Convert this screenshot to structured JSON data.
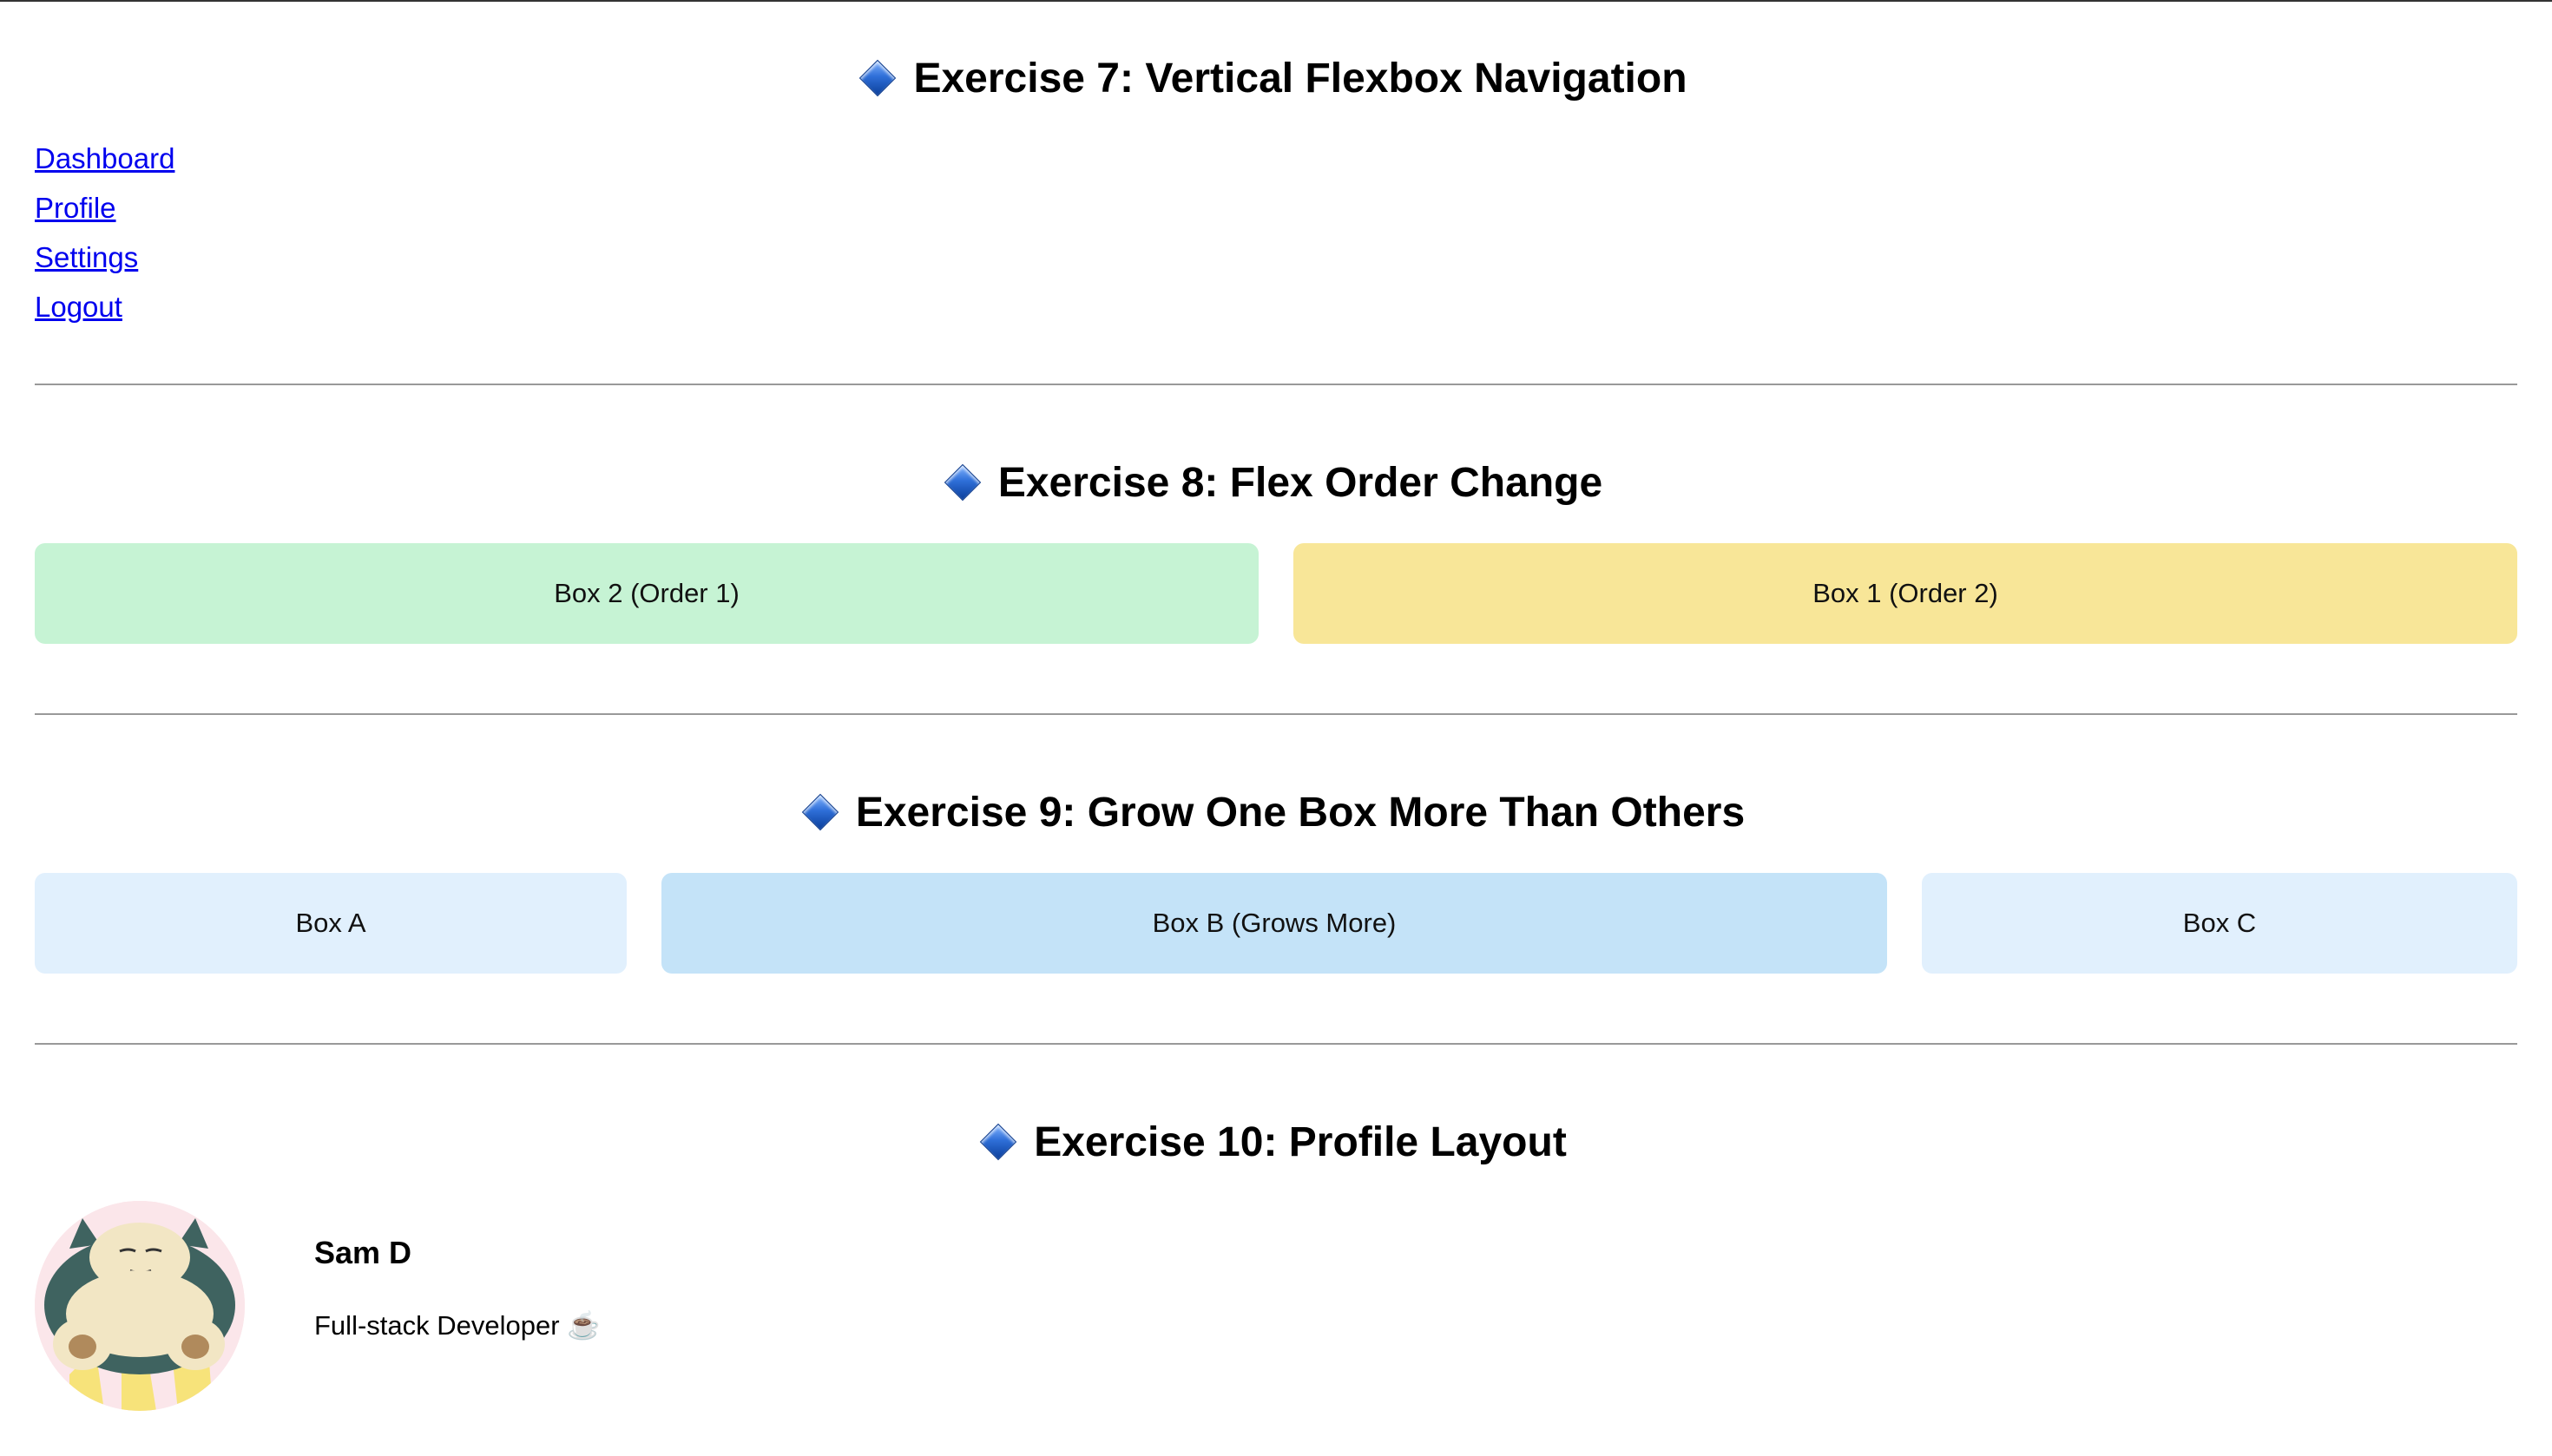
{
  "ex7": {
    "title": "Exercise 7: Vertical Flexbox Navigation",
    "nav": [
      "Dashboard",
      "Profile",
      "Settings",
      "Logout"
    ]
  },
  "ex8": {
    "title": "Exercise 8: Flex Order Change",
    "boxes": [
      "Box 2 (Order 1)",
      "Box 1 (Order 2)"
    ],
    "colors": [
      "#c6f3d4",
      "#f8e698"
    ]
  },
  "ex9": {
    "title": "Exercise 9: Grow One Box More Than Others",
    "boxes": [
      "Box A",
      "Box B (Grows More)",
      "Box C"
    ],
    "colors": [
      "#e1f0fd",
      "#c4e3f8",
      "#e1f0fd"
    ]
  },
  "ex10": {
    "title": "Exercise 10: Profile Layout",
    "name": "Sam D",
    "role": "Full-stack Developer ☕"
  },
  "icons": {
    "heading": "blue-diamond-icon",
    "avatar": "snorlax-avatar"
  },
  "colors": {
    "link": "#0000ee",
    "divider": "#999999"
  }
}
